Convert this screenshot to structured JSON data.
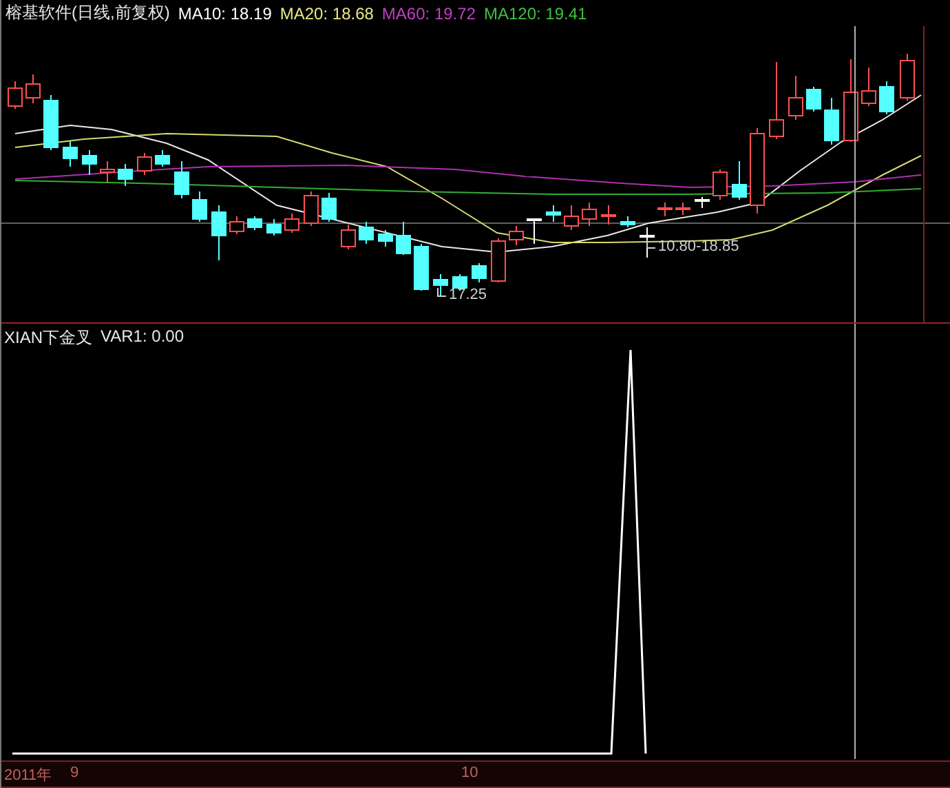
{
  "header": {
    "title": "榕基软件(日线,前复权)",
    "indicators": [
      {
        "label": "MA10: 18.19",
        "color": "#ffffff"
      },
      {
        "label": "MA20: 18.68",
        "color": "#e8e88a"
      },
      {
        "label": "MA60: 19.72",
        "color": "#c040c0"
      },
      {
        "label": "MA120: 19.41",
        "color": "#40c040"
      }
    ]
  },
  "price_chart": {
    "annotations": [
      "17.25",
      "10.80-18.85"
    ]
  },
  "indicator_panel": {
    "title": "XIAN下金叉",
    "reading": "VAR1: 0.00"
  },
  "time_axis": {
    "labels": [
      "2011年",
      "9",
      "10"
    ]
  }
}
